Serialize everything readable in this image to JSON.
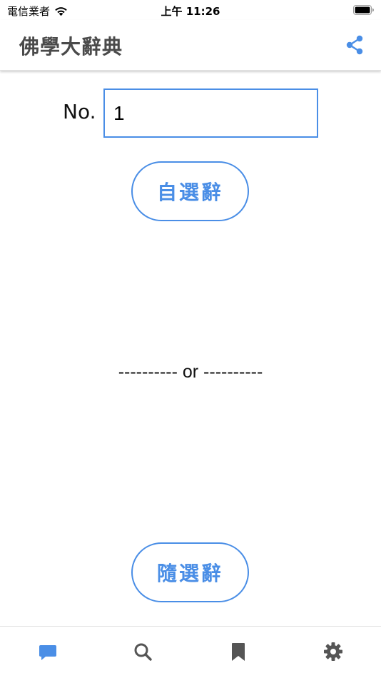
{
  "status_bar": {
    "carrier": "電信業者",
    "time": "上午 11:26"
  },
  "nav": {
    "title": "佛學大辭典",
    "share_icon": "share-icon"
  },
  "number_field": {
    "label": "No.",
    "value": "1"
  },
  "buttons": {
    "select_label": "自選辭",
    "random_label": "隨選辭"
  },
  "divider": {
    "text": "---------- or ----------"
  },
  "tab_bar": {
    "tabs": [
      {
        "icon": "chat-icon",
        "active": true
      },
      {
        "icon": "search-icon",
        "active": false
      },
      {
        "icon": "bookmark-icon",
        "active": false
      },
      {
        "icon": "gear-icon",
        "active": false
      }
    ]
  },
  "colors": {
    "accent": "#4a8ee6",
    "title_text": "#4a4a4a",
    "inactive_icon": "#555555"
  }
}
